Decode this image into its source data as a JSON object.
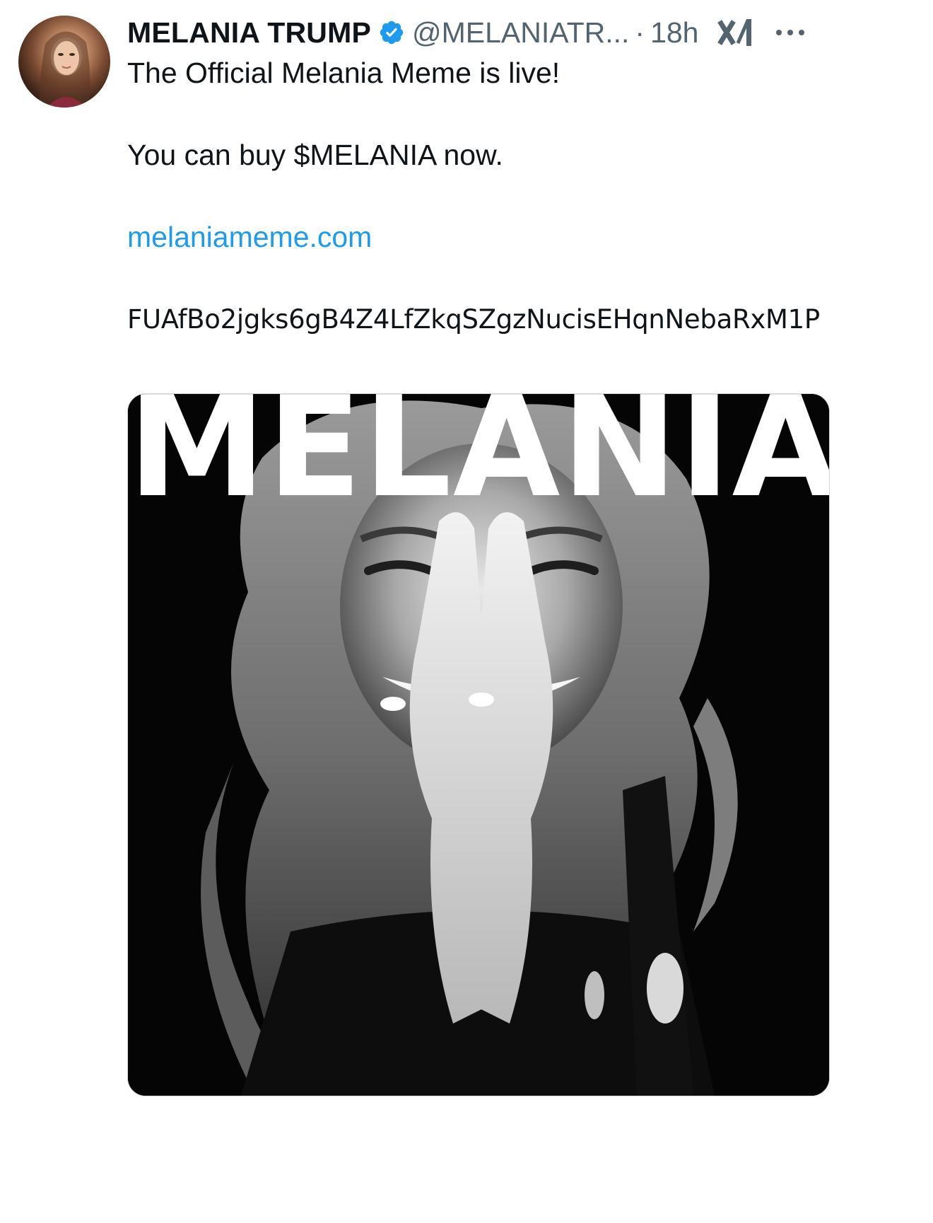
{
  "post": {
    "author": {
      "display_name": "MELANIA TRUMP",
      "handle": "@MELANIATR...",
      "verified": true,
      "avatar_icon": "profile-photo"
    },
    "separator": "·",
    "time": "18h",
    "text": {
      "line1": "The Official Melania Meme is live!",
      "line2": "You can buy $MELANIA now.",
      "link": "melaniameme.com",
      "contract": "FUAfBo2jgks6gB4Z4LfZkqSZgzNucisEHqnNebaRxM1P"
    },
    "media": {
      "title": "MELANIA",
      "type": "black-and-white portrait photo"
    }
  },
  "icons": {
    "verified": "verified-badge-icon",
    "grok": "grok-icon",
    "more": "more-options-icon"
  },
  "colors": {
    "primary_text": "#0f1419",
    "secondary_text": "#536471",
    "link": "#1d9bf0",
    "verified_badge": "#1d9bf0"
  }
}
